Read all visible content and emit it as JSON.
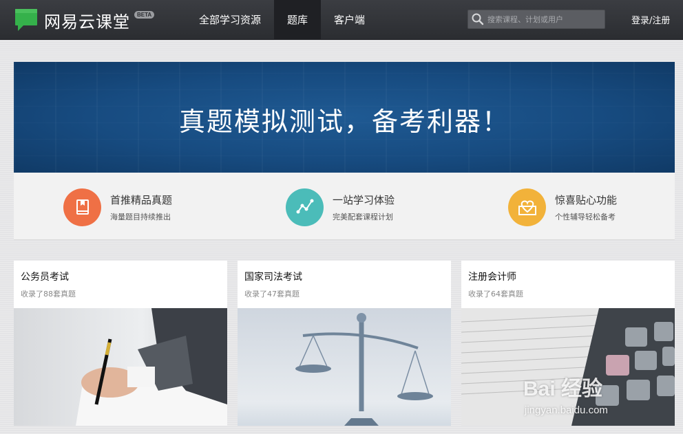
{
  "header": {
    "logo_text": "网易云课堂",
    "beta_badge": "BETA",
    "nav": [
      {
        "label": "全部学习资源",
        "active": false
      },
      {
        "label": "题库",
        "active": true
      },
      {
        "label": "客户端",
        "active": false
      }
    ],
    "search": {
      "placeholder": "搜索课程、计划或用户",
      "value": ""
    },
    "login_label": "登录/注册"
  },
  "banner": {
    "title": "真题模拟测试，备考利器！"
  },
  "features": [
    {
      "title": "首推精品真题",
      "desc": "海量题目持续推出",
      "icon": "book-icon",
      "color": "#ef7045"
    },
    {
      "title": "一站学习体验",
      "desc": "完美配套课程计划",
      "icon": "line-chart-icon",
      "color": "#4bbcb9"
    },
    {
      "title": "惊喜贴心功能",
      "desc": "个性辅导轻松备考",
      "icon": "heart-envelope-icon",
      "color": "#f2b23a"
    }
  ],
  "cards": [
    {
      "title": "公务员考试",
      "subtitle": "收录了88套真题",
      "image": "hand-writing-image"
    },
    {
      "title": "国家司法考试",
      "subtitle": "收录了47套真题",
      "image": "scales-of-justice-image"
    },
    {
      "title": "注册会计师",
      "subtitle": "收录了64套真题",
      "image": "calculator-image"
    }
  ],
  "watermark": {
    "text": "Bai 经验",
    "url": "jingyan.baidu.com"
  }
}
